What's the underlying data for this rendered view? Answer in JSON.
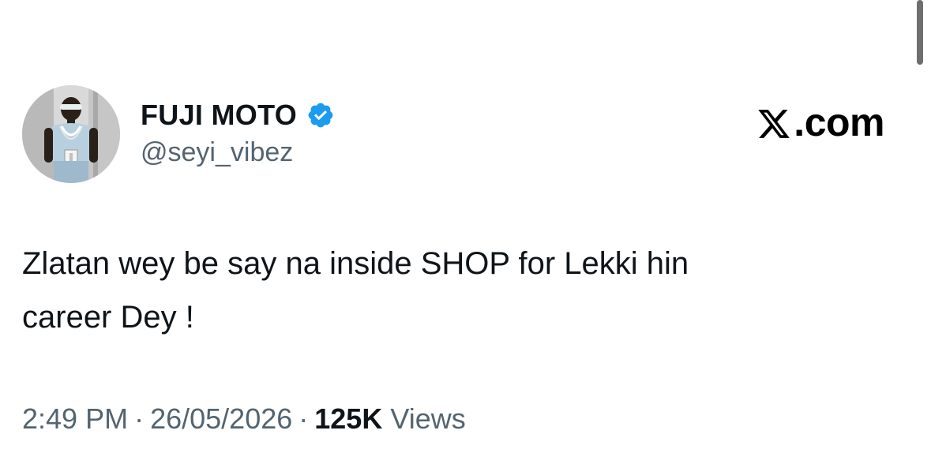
{
  "author": {
    "display_name": "FUJI MOTO",
    "handle": "@seyi_vibez",
    "verified": true,
    "verified_color": "#1d9bf0"
  },
  "brand": {
    "label": ".com",
    "logo_icon": "x-logo-icon"
  },
  "tweet": {
    "text": "Zlatan wey be say na inside SHOP for Lekki hin\ncareer Dey !"
  },
  "meta": {
    "time": "2:49 PM",
    "date": "26/05/2026",
    "separator": "·",
    "views_count": "125K",
    "views_label": "Views"
  },
  "colors": {
    "text_primary": "#0f1419",
    "text_secondary": "#536471",
    "background": "#ffffff"
  }
}
